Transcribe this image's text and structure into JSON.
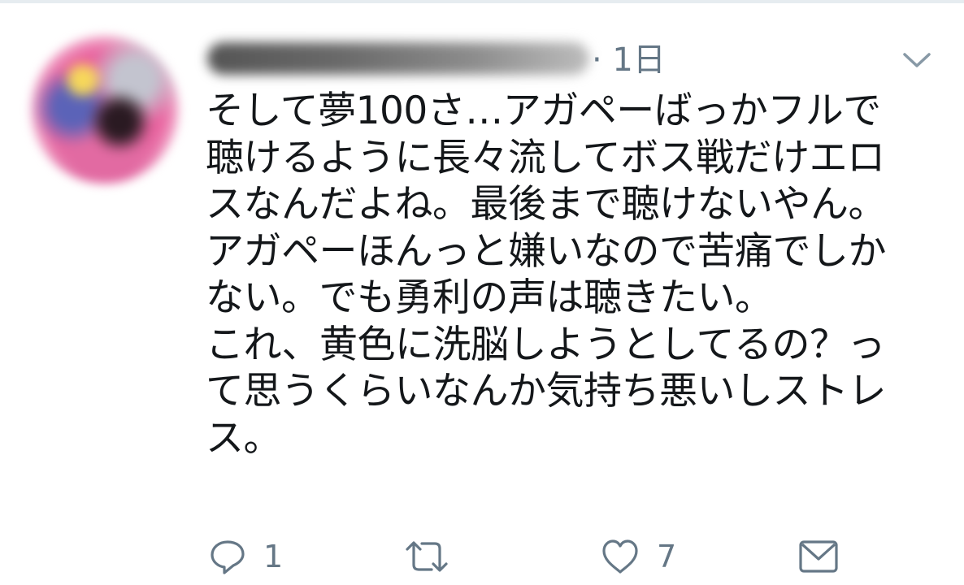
{
  "tweet": {
    "timestamp": "· 1日",
    "lines": [
      "そして夢100さ…アガペーばっかフルで",
      "聴けるように長々流してボス戦だけエロ",
      "スなんだよね。最後まで聴けないやん。",
      "アガペーほんっと嫌いなので苦痛でしか",
      "ない。でも勇利の声は聴きたい。",
      "これ、黄色に洗脳しようとしてるの？っ",
      "て思うくらいなんか気持ち悪いしストレ",
      "ス。"
    ]
  },
  "actions": {
    "reply_count": "1",
    "retweet_count": "",
    "like_count": "7"
  },
  "icons": {
    "menu": "chevron-down-icon",
    "reply": "reply-icon",
    "retweet": "retweet-icon",
    "like": "heart-icon",
    "dm": "envelope-icon"
  },
  "colors": {
    "text": "#14171a",
    "secondary": "#657786",
    "border": "#e6ecf0"
  }
}
